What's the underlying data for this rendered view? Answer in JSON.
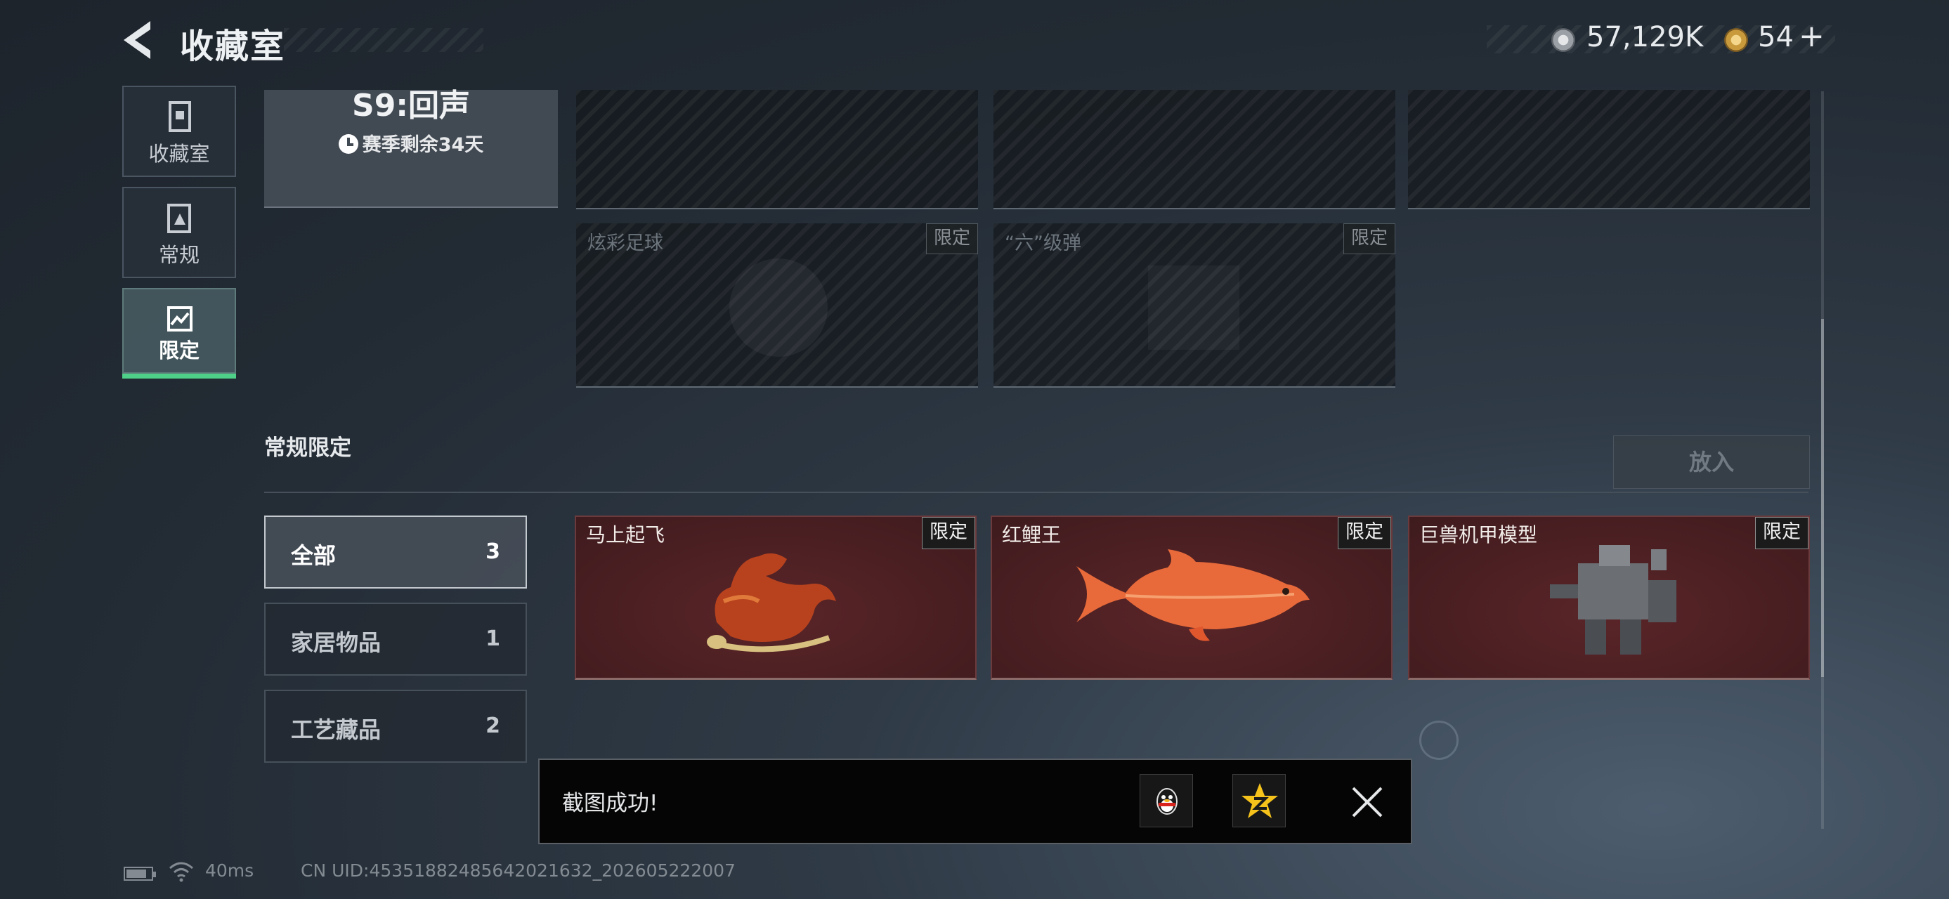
{
  "header": {
    "title": "收藏室",
    "currency1_value": "57,129K",
    "currency2_value": "54",
    "currency2_plus": "+",
    "currency1_icon": "silver-coin-icon",
    "currency2_icon": "gold-coin-icon"
  },
  "side_tabs": [
    {
      "label": "收藏室",
      "icon": "cabinet-icon",
      "active": false
    },
    {
      "label": "常规",
      "icon": "document-icon",
      "active": false
    },
    {
      "label": "限定",
      "icon": "image-icon",
      "active": true
    }
  ],
  "season": {
    "title": "S9:回声",
    "remaining": "赛季剩余34天",
    "icon": "clock-icon"
  },
  "locked_items": [
    {
      "name": "炫彩足球",
      "tag": "限定"
    },
    {
      "name": "“六”级弹",
      "tag": "限定"
    }
  ],
  "section": {
    "title": "常规限定",
    "put_button": "放入"
  },
  "filters": [
    {
      "label": "全部",
      "count": "3",
      "active": true
    },
    {
      "label": "家居物品",
      "count": "1",
      "active": false
    },
    {
      "label": "工艺藏品",
      "count": "2",
      "active": false
    }
  ],
  "items": [
    {
      "name": "马上起飞",
      "tag": "限定"
    },
    {
      "name": "红鲤王",
      "tag": "限定"
    },
    {
      "name": "巨兽机甲模型",
      "tag": "限定"
    }
  ],
  "toast": {
    "message": "截图成功!",
    "share_icons": [
      "qq-icon",
      "qzone-icon"
    ],
    "close_icon": "close-icon"
  },
  "status_bar": {
    "ping": "40ms",
    "uid": "CN UID:4535188248564​2021632_202605222007"
  },
  "colors": {
    "accent_green": "#4ed089",
    "item_background": "#4a1f22"
  }
}
